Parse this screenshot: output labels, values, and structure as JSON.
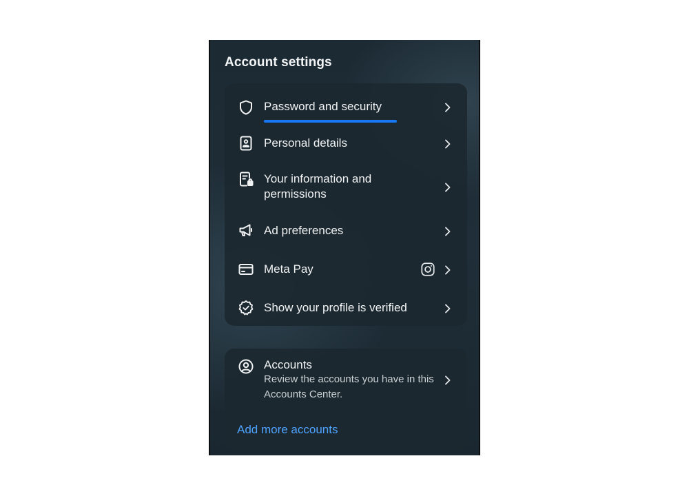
{
  "section_title": "Account settings",
  "account_settings": {
    "items": [
      {
        "label": "Password and security",
        "icon": "shield-icon"
      },
      {
        "label": "Personal details",
        "icon": "id-card-icon"
      },
      {
        "label": "Your information and permissions",
        "icon": "document-lock-icon"
      },
      {
        "label": "Ad preferences",
        "icon": "megaphone-icon"
      },
      {
        "label": "Meta Pay",
        "icon": "credit-card-icon",
        "badge": "instagram-icon"
      },
      {
        "label": "Show your profile is verified",
        "icon": "verified-badge-icon"
      }
    ]
  },
  "accounts": {
    "title": "Accounts",
    "description": "Review the accounts you have in this Accounts Center.",
    "icon": "user-circle-icon",
    "add_link": "Add more accounts"
  },
  "colors": {
    "accent_underline": "#1877f2",
    "link": "#4ea3ff"
  }
}
